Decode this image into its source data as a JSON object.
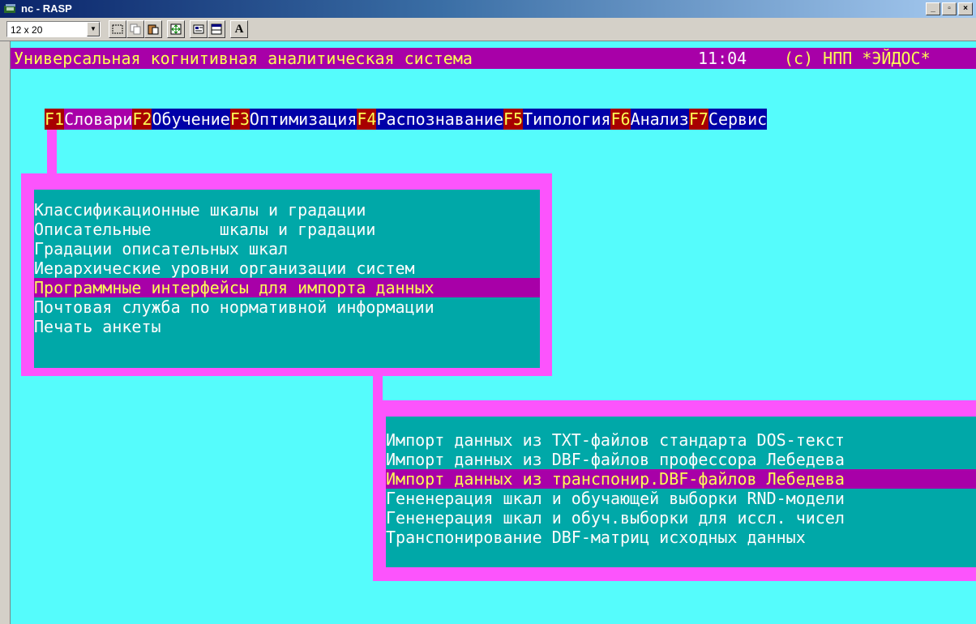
{
  "window": {
    "title": "nc - RASP",
    "min_label": "_",
    "max_label": "▫",
    "close_label": "×"
  },
  "toolbar": {
    "font_size": "12 x 20",
    "font_icon": "A"
  },
  "status": {
    "title": "Универсальная когнитивная аналитическая система",
    "time": "11:04",
    "copyright": "(c) НПП *ЭЙДОС*"
  },
  "menu": [
    {
      "key": "F1",
      "label": "Словари"
    },
    {
      "key": "F2",
      "label": "Обучение"
    },
    {
      "key": "F3",
      "label": "Оптимизация"
    },
    {
      "key": "F4",
      "label": "Распознавание"
    },
    {
      "key": "F5",
      "label": "Типология"
    },
    {
      "key": "F6",
      "label": "Анализ"
    },
    {
      "key": "F7",
      "label": "Сервис"
    }
  ],
  "submenu1": {
    "items": [
      "Классификационные шкалы и градации",
      "Описательные       шкалы и градации",
      "Градации описательных шкал",
      "Иерархические уровни организации систем",
      "Программные интерфейсы для импорта данных",
      "Почтовая служба по нормативной информации",
      "Печать анкеты"
    ],
    "selected_index": 4
  },
  "submenu2": {
    "items": [
      "Импорт данных из TXT-файлов стандарта DOS-текст",
      "Импорт данных из DBF-файлов профессора Лебедева",
      "Импорт данных из транспонир.DBF-файлов Лебедева",
      "Гененерация шкал и обучающей выборки RND-модели",
      "Гененерация шкал и обуч.выборки для иссл. чисел",
      "Транспонирование DBF-матриц исходных данных"
    ],
    "selected_index": 2
  },
  "colors": {
    "console_bg": "#55fcfc",
    "panel_frame": "#fc54fc",
    "panel_bg": "#00a8a8",
    "highlight": "#a800a8",
    "menu_bg": "#0000a8",
    "fkey_bg": "#a80000"
  }
}
